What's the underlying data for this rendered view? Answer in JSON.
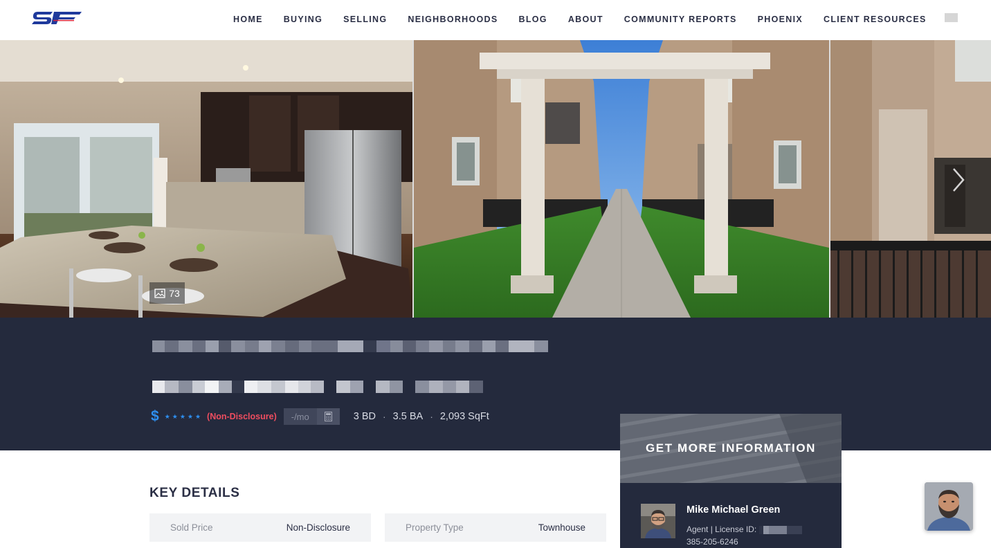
{
  "header": {
    "logo_text": "SF",
    "nav": [
      "HOME",
      "BUYING",
      "SELLING",
      "NEIGHBORHOODS",
      "BLOG",
      "ABOUT",
      "COMMUNITY REPORTS",
      "PHOENIX",
      "CLIENT RESOURCES"
    ]
  },
  "gallery": {
    "photo_count": "73"
  },
  "listing": {
    "price_symbol": "$",
    "stars": "★★★★★",
    "price_text": "(Non-Disclosure)",
    "mortgage_placeholder": "-/mo",
    "beds": "3 BD",
    "baths": "3.5 BA",
    "sqft": "2,093 SqFt",
    "separator": "·"
  },
  "key_details": {
    "title": "KEY DETAILS",
    "items": [
      {
        "label": "Sold Price",
        "value": "Non-Disclosure"
      },
      {
        "label": "Property Type",
        "value": "Townhouse"
      }
    ]
  },
  "info_panel": {
    "title": "GET MORE INFORMATION",
    "agent_name": "Mike Michael Green",
    "agent_license_label": "Agent | License ID:",
    "agent_phone": "385-205-6246"
  },
  "colors": {
    "brand_navy": "#242a3d",
    "accent_blue": "#2e8ff0",
    "nondisclosure_red": "#ee4d5f",
    "logo_blue": "#1f3a9c"
  }
}
